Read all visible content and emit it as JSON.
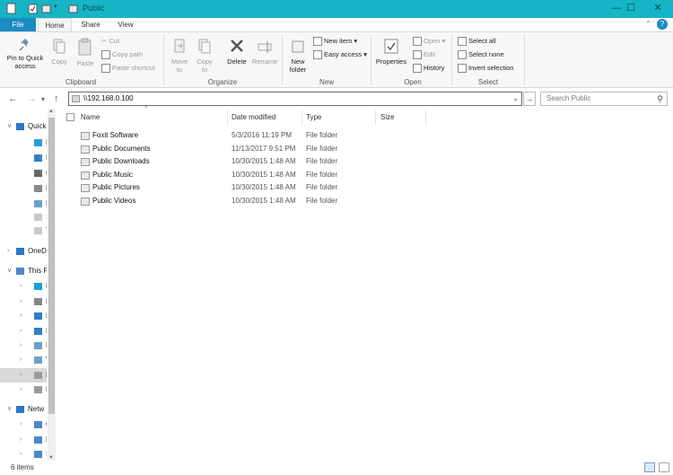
{
  "window": {
    "title": "Public",
    "controls": {
      "minimize": "—",
      "maximize": "☐",
      "close": "✕"
    }
  },
  "ribbon_tabs": [
    "File",
    "Home",
    "Share",
    "View"
  ],
  "ribbon": {
    "clipboard": {
      "label": "Clipboard",
      "pin": "Pin to Quick access",
      "copy": "Copy",
      "paste": "Paste",
      "cut": "Cut",
      "copy_path": "Copy path",
      "paste_shortcut": "Paste shortcut"
    },
    "organize": {
      "label": "Organize",
      "move_to": "Move to",
      "copy_to": "Copy to",
      "delete": "Delete",
      "rename": "Rename"
    },
    "new": {
      "label": "New",
      "new_folder": "New folder",
      "new_item": "New item",
      "easy_access": "Easy access"
    },
    "open": {
      "label": "Open",
      "properties": "Properties",
      "open": "Open",
      "edit": "Edit",
      "history": "History"
    },
    "select": {
      "label": "Select",
      "select_all": "Select all",
      "select_none": "Select none",
      "invert_selection": "Invert selection"
    }
  },
  "address": {
    "path": "\\\\192.168.0.100",
    "search_placeholder": "Search Public"
  },
  "nav_pane": [
    {
      "label": "Quick",
      "icon": "star-icon",
      "indent": 0,
      "expander": "down"
    },
    {
      "label": "D",
      "icon": "desktop-icon",
      "indent": 1,
      "pinned": true
    },
    {
      "label": "D",
      "icon": "download-icon",
      "indent": 1,
      "pinned": true
    },
    {
      "label": "G",
      "icon": "network-drive-icon",
      "indent": 1,
      "pinned": true
    },
    {
      "label": "D",
      "icon": "document-icon",
      "indent": 1,
      "pinned": true
    },
    {
      "label": "P",
      "icon": "picture-icon",
      "indent": 1,
      "pinned": true
    },
    {
      "label": "1",
      "icon": "folder-icon",
      "indent": 1,
      "pinned": false
    },
    {
      "label": "T",
      "icon": "folder-icon",
      "indent": 1,
      "pinned": false
    },
    {
      "label": "OneD",
      "icon": "cloud-icon",
      "indent": 0,
      "expander": "right"
    },
    {
      "label": "This P",
      "icon": "computer-icon",
      "indent": 0,
      "expander": "down"
    },
    {
      "label": "Des",
      "icon": "desktop-icon",
      "indent": 1,
      "expander": "right"
    },
    {
      "label": "Doc",
      "icon": "document-icon",
      "indent": 1,
      "expander": "right"
    },
    {
      "label": "Dow",
      "icon": "download-icon",
      "indent": 1,
      "expander": "right"
    },
    {
      "label": "Mus",
      "icon": "music-icon",
      "indent": 1,
      "expander": "right"
    },
    {
      "label": "Pict",
      "icon": "picture-icon",
      "indent": 1,
      "expander": "right"
    },
    {
      "label": "Vide",
      "icon": "video-icon",
      "indent": 1,
      "expander": "right"
    },
    {
      "label": "Loc",
      "icon": "drive-icon",
      "indent": 1,
      "expander": "right",
      "selected": true
    },
    {
      "label": "Mu",
      "icon": "drive-icon",
      "indent": 1,
      "expander": "right"
    },
    {
      "label": "Netw",
      "icon": "network-icon",
      "indent": 0,
      "expander": "down"
    },
    {
      "label": "COI",
      "icon": "computer-icon",
      "indent": 1,
      "expander": "right"
    },
    {
      "label": "NEX",
      "icon": "computer-icon",
      "indent": 1,
      "expander": "right"
    },
    {
      "label": "SL-I",
      "icon": "computer-icon",
      "indent": 1,
      "expander": "right"
    }
  ],
  "columns": [
    "Name",
    "Date modified",
    "Type",
    "Size"
  ],
  "files": [
    {
      "name": "Foxit Software",
      "date": "5/3/2016 11:19 PM",
      "type": "File folder"
    },
    {
      "name": "Public Documents",
      "date": "11/13/2017 9:51 PM",
      "type": "File folder"
    },
    {
      "name": "Public Downloads",
      "date": "10/30/2015 1:48 AM",
      "type": "File folder"
    },
    {
      "name": "Public Music",
      "date": "10/30/2015 1:48 AM",
      "type": "File folder"
    },
    {
      "name": "Public Pictures",
      "date": "10/30/2015 1:48 AM",
      "type": "File folder"
    },
    {
      "name": "Public Videos",
      "date": "10/30/2015 1:48 AM",
      "type": "File folder"
    }
  ],
  "status": {
    "item_count": "6 items"
  },
  "colors": {
    "titlebar": "#16b5c6",
    "file_tab": "#1a8cc2",
    "selection": "#d9d9d9"
  }
}
